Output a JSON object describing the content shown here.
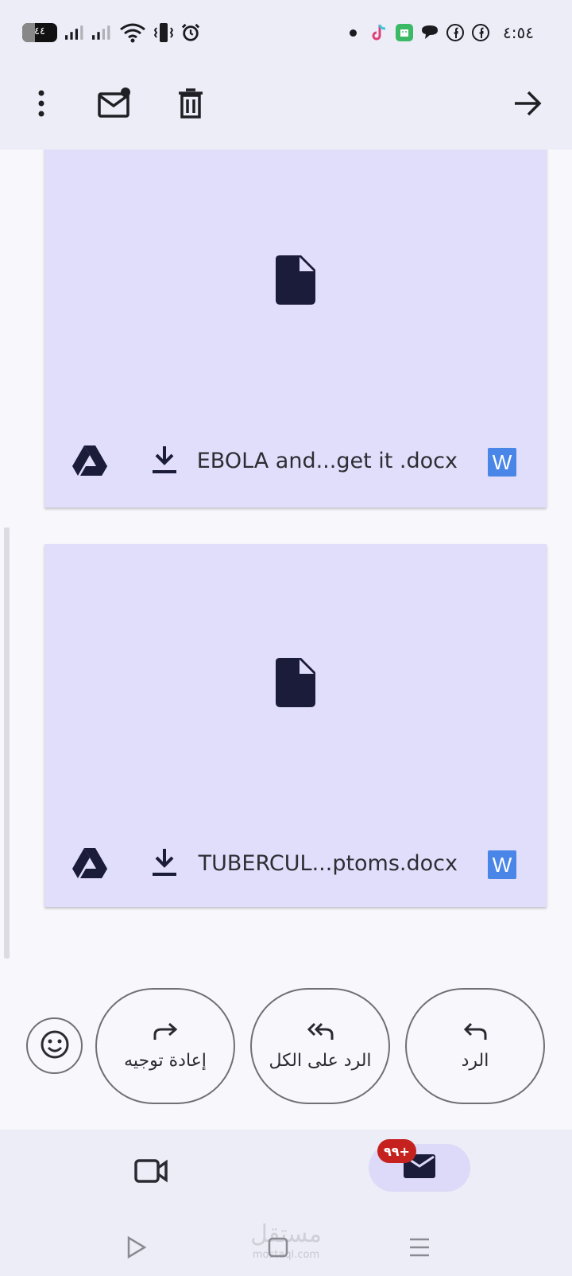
{
  "status_bar": {
    "time": "٤:٥٤",
    "battery": "٤٤",
    "icons": [
      "battery-icon",
      "signal-icon",
      "signal-icon",
      "wifi-icon",
      "vibrate-icon",
      "alarm-icon",
      "dot-icon",
      "tiktok-icon",
      "shop-icon",
      "chat-icon",
      "facebook-icon",
      "facebook-icon"
    ]
  },
  "toolbar": {
    "icons": [
      "more-vert-icon",
      "mark-unread-icon",
      "delete-icon",
      "forward-arrow-icon"
    ]
  },
  "attachments": [
    {
      "file_name": "EBOLA and...get it .docx",
      "type_badge": "W"
    },
    {
      "file_name": "TUBERCUL...ptoms.docx",
      "type_badge": "W"
    }
  ],
  "reply_actions": {
    "reply": "الرد",
    "reply_all": "الرد على الكل",
    "forward": "إعادة توجيه"
  },
  "bottom_nav": {
    "mail_badge": "٩٩+"
  },
  "watermark": {
    "text": "مستقل",
    "sub": "mostaql.com"
  },
  "colors": {
    "card_bg": "#e0defb",
    "bar_bg": "#ecedf7",
    "word_blue": "#4a86e8",
    "badge_red": "#c5221f",
    "icon_dark": "#1b1b3a"
  }
}
